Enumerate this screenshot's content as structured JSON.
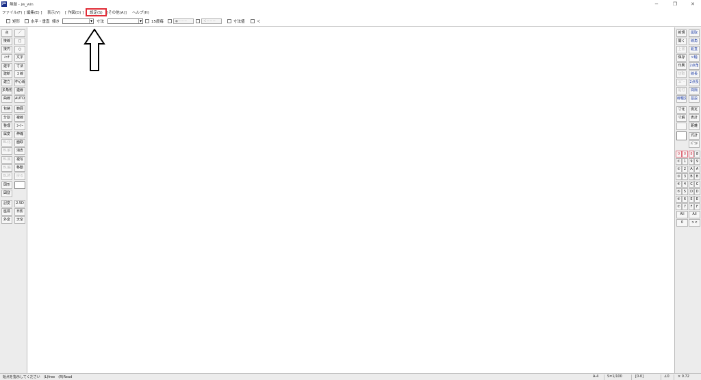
{
  "window": {
    "app_icon": "jw",
    "title": "無題 - jw_win",
    "minimize_glyph": "−",
    "restore_glyph": "❐",
    "close_glyph": "✕"
  },
  "menu": [
    "ファイル(F)",
    "[ 編集(E) ]",
    "表示(V)",
    "[ 作図(D) ]",
    "設定(S)",
    "[その他(A)]",
    "ヘルプ(H)"
  ],
  "highlight_color": "#e02b36",
  "toolbar": {
    "rect": "矩形",
    "horiz_vert": "水平・垂直",
    "continuation": "傾き",
    "dimension": "寸法",
    "deg15": "15度毎",
    "btn_a": "●－－－",
    "btn_b": "＜－－－",
    "dim_value": "寸法値",
    "last": "＜"
  },
  "left_toolbar": [
    [
      "点",
      "／"
    ],
    [
      "接線",
      "□"
    ],
    [
      "接円",
      "○"
    ],
    [
      "ﾊｯﾁ",
      "文字"
    ],
    [
      "建平",
      "寸法"
    ],
    [
      "建断",
      "２線"
    ],
    [
      "建立",
      "中心線"
    ],
    [
      "多角形",
      "連線"
    ],
    [
      "曲線",
      "AUTO"
    ],
    [
      "包絡",
      "範囲"
    ],
    [
      "分割",
      "複線"
    ],
    [
      "整理",
      "ｺｰﾅｰ"
    ],
    [
      "属変",
      "伸縮"
    ],
    [
      "BL化",
      "面取"
    ],
    [
      "BL解",
      "消去"
    ],
    [
      "BL属",
      "複写"
    ],
    [
      "BL編",
      "移動"
    ],
    [
      "BL終",
      "戻る"
    ],
    [
      "図形",
      ""
    ],
    [
      "図登",
      ""
    ],
    [
      "記変",
      "2.5D"
    ],
    [
      "座標",
      "日影"
    ],
    [
      "外変",
      "天空"
    ]
  ],
  "right_toolbar": [
    [
      "新規",
      "属取"
    ],
    [
      "開く",
      "線角"
    ],
    [
      "上書",
      "鉛直"
    ],
    [
      "保存",
      "×軸"
    ],
    [
      "印刷",
      "2点角"
    ],
    [
      "切取",
      "線長"
    ],
    [
      "ｺﾋﾟｰ",
      "2点長"
    ],
    [
      "貼付",
      "間隔"
    ],
    [
      "線種変",
      "基設"
    ],
    [
      "寸化",
      "測定"
    ],
    [
      "寸解",
      "表計"
    ],
    [
      "",
      "距離"
    ],
    [
      "",
      "式計"
    ],
    [
      "",
      "ﾊﾟﾗﾒ"
    ]
  ],
  "layer_groups": {
    "left": [
      "0",
      "①",
      "②",
      "③",
      "④",
      "⑤",
      "⑥",
      "⑦"
    ],
    "right": [
      "0",
      "1",
      "2",
      "3",
      "4",
      "5",
      "6",
      "7"
    ],
    "left_b": [
      "8",
      "9",
      "A",
      "B",
      "C",
      "D",
      "E",
      "F"
    ],
    "right_b": [
      "8",
      "9",
      "A",
      "B",
      "C",
      "D",
      "E",
      "F"
    ],
    "all_left": "All",
    "all_right": "All",
    "zero": "0",
    "arrows": "><"
  },
  "status": {
    "message": "始点を指示してください　(L)free　(R)Read",
    "paper": "A-4",
    "scale": "S=1/100",
    "layer": "[0-0]",
    "angle": "∠0",
    "zoom": "× 0.72"
  }
}
